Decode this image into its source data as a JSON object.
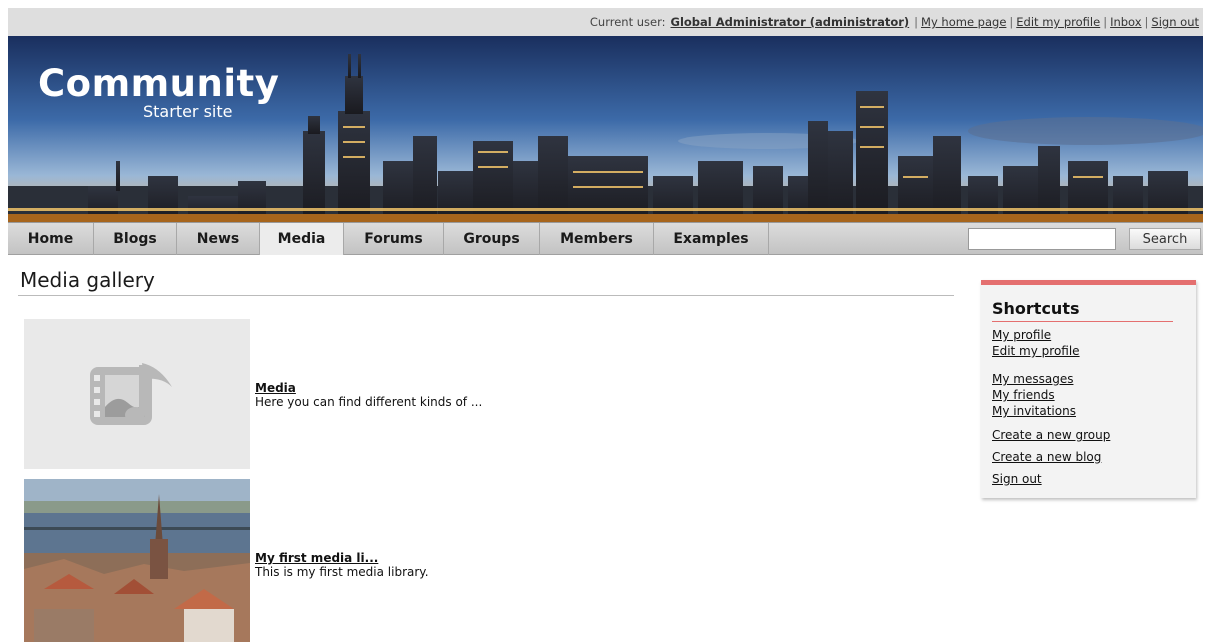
{
  "header": {
    "current_user_label": "Current user:",
    "current_user_name": "Global Administrator (administrator)",
    "links": [
      "My home page",
      "Edit my profile",
      "Inbox",
      "Sign out"
    ]
  },
  "logo": {
    "title": "Community",
    "subtitle": "Starter site"
  },
  "nav": {
    "items": [
      "Home",
      "Blogs",
      "News",
      "Media",
      "Forums",
      "Groups",
      "Members",
      "Examples"
    ],
    "active": "Media",
    "search_value": "",
    "search_button": "Search"
  },
  "main": {
    "title": "Media gallery",
    "items": [
      {
        "name": "Media",
        "description": "Here you can find different kinds of ...",
        "thumb_icon": "media-icon"
      },
      {
        "name": "My first media li...",
        "description": "This is my first media library.",
        "thumb_icon": "city-photo"
      }
    ]
  },
  "shortcuts": {
    "title": "Shortcuts",
    "links": [
      "My profile",
      "Edit my profile",
      "My messages",
      "My friends",
      "My invitations",
      "Create a new group",
      "Create a new blog",
      "Sign out"
    ],
    "accent_color": "#e46f6f"
  },
  "colors": {
    "user_bar": "#dedede",
    "nav_bg": "#c8c8c8",
    "sky_top": "#1c3566",
    "sky_bottom": "#e0a45a"
  }
}
